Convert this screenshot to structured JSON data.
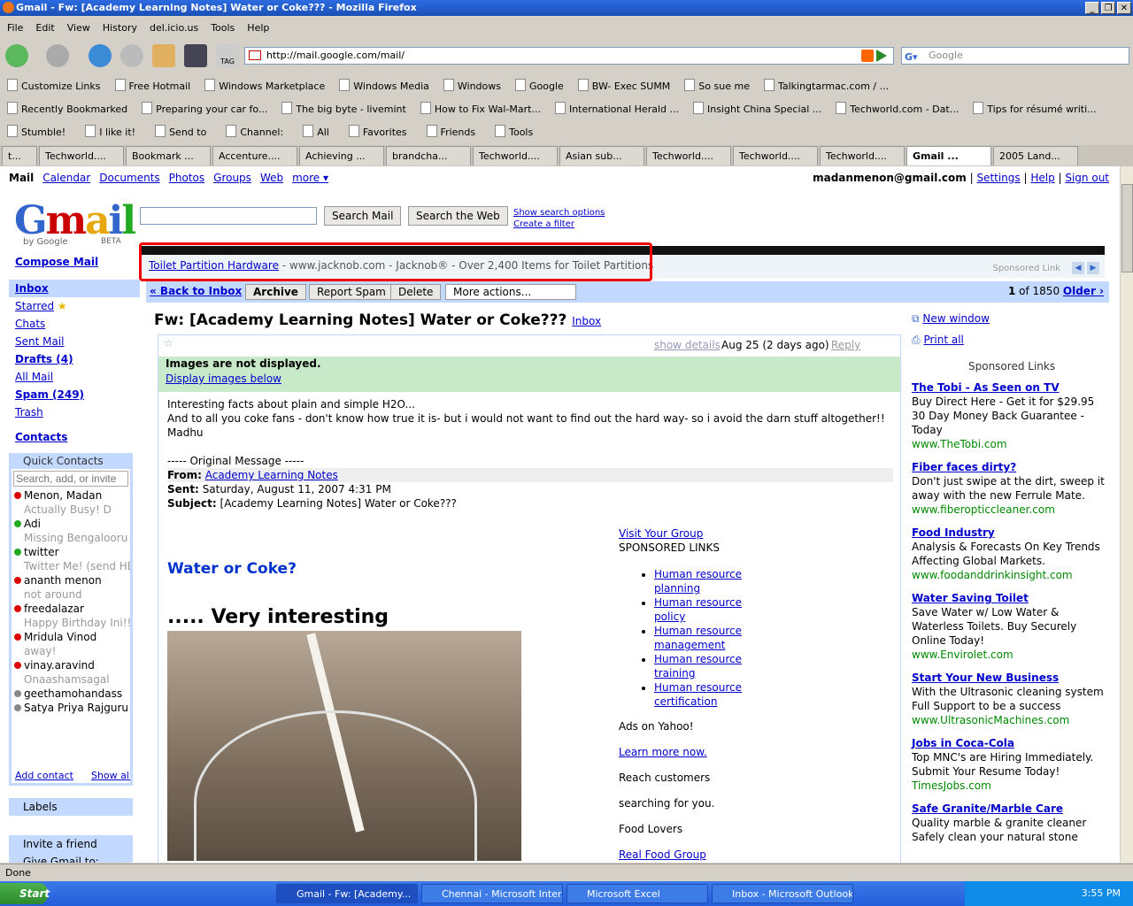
{
  "window": {
    "title": "Gmail - Fw: [Academy Learning Notes] Water or Coke??? - Mozilla Firefox"
  },
  "menu": [
    "File",
    "Edit",
    "View",
    "History",
    "del.icio.us",
    "Tools",
    "Help"
  ],
  "url": "http://mail.google.com/mail/",
  "search_placeholder": "Google",
  "bookmarks1": [
    "Customize Links",
    "Free Hotmail",
    "Windows Marketplace",
    "Windows Media",
    "Windows",
    "Google",
    "BW- Exec SUMM",
    "So sue me",
    "Talkingtarmac.com / ..."
  ],
  "bookmarks2": [
    "Recently Bookmarked",
    "Preparing your car fo...",
    "The big byte - livemint",
    "How to Fix Wal-Mart...",
    "International Herald ...",
    "Insight China Special ...",
    "Techworld.com - Dat...",
    "Tips for résumé writi..."
  ],
  "stumble": [
    "Stumble!",
    "I like it!",
    "Send to",
    "Channel:",
    "All",
    "Favorites",
    "Friends",
    "Tools"
  ],
  "tabs": [
    "t...",
    "Techworld....",
    "Bookmark ...",
    "Accenture....",
    "Achieving ...",
    "brandcha...",
    "Techworld....",
    "Asian sub...",
    "Techworld....",
    "Techworld....",
    "Techworld....",
    "Gmail ...",
    "2005 Land..."
  ],
  "gmail": {
    "top_links": [
      "Mail",
      "Calendar",
      "Documents",
      "Photos",
      "Groups",
      "Web",
      "more ▾"
    ],
    "user": "madanmenon@gmail.com",
    "settings": "Settings",
    "help": "Help",
    "signout": "Sign out",
    "search_mail": "Search Mail",
    "search_web": "Search the Web",
    "show_opts": "Show search options",
    "create_filter": "Create a filter",
    "logo": "Gmail",
    "logo_sub": "by Google",
    "logo_beta": "BETA",
    "ad_link": "Toilet Partition Hardware",
    "ad_rest": " - www.jacknob.com - Jacknob® - Over 2,400 Items for Toilet Partitions",
    "ad_sponsor": "Sponsored Link",
    "compose": "Compose Mail",
    "nav": [
      "Inbox",
      "Starred",
      "Chats",
      "Sent Mail",
      "Drafts (4)",
      "All Mail",
      "Spam (249)",
      "Trash"
    ],
    "contacts": "Contacts",
    "qc_title": "Quick Contacts",
    "qc_placeholder": "Search, add, or invite",
    "qc_list": [
      {
        "n": "Menon, Madan",
        "s": "Actually Busy! D",
        "c": "#d00"
      },
      {
        "n": "Adi",
        "s": "Missing Bengalooru",
        "c": "#2a2"
      },
      {
        "n": "twitter",
        "s": "Twitter Me! (send HE",
        "c": "#2a2"
      },
      {
        "n": "ananth menon",
        "s": "not around",
        "c": "#d00"
      },
      {
        "n": "freedalazar",
        "s": "Happy Birthday Ini!!",
        "c": "#d00"
      },
      {
        "n": "Mridula Vinod",
        "s": "away!",
        "c": "#d00"
      },
      {
        "n": "vinay.aravind",
        "s": "Onaashamsagal",
        "c": "#d00"
      },
      {
        "n": "geethamohandass",
        "s": "",
        "c": "#888"
      },
      {
        "n": "Satya Priya Rajguru",
        "s": "",
        "c": "#888"
      }
    ],
    "add_contact": "Add contact",
    "show_all": "Show all",
    "labels": "Labels",
    "invite": "Invite a friend",
    "invite_sub": "Give Gmail to:",
    "back": "« Back to Inbox",
    "archive": "Archive",
    "report": "Report Spam",
    "delete": "Delete",
    "more_actions": "More actions...",
    "count": "1",
    "of": "of 1850",
    "older": "Older ›",
    "subject": "Fw: [Academy Learning Notes] Water or Coke???",
    "inbox_label": "Inbox",
    "show_details": "show details",
    "date": "Aug 25 (2 days ago)",
    "reply": "Reply",
    "img_warn": "Images are not displayed.",
    "display_images": "Display images below",
    "body": [
      "Interesting facts about plain and simple H2O...",
      "And to all you coke fans - don't know how true it is- but i would not want to find out the hard way- so i avoid the darn stuff altogether!!",
      "Madhu"
    ],
    "orig": "----- Original Message -----",
    "from_l": "From:",
    "from": "Academy Learning Notes",
    "sent_l": "Sent:",
    "sent": "Saturday, August 11, 2007 4:31 PM",
    "subj_l": "Subject:",
    "subj": "[Academy Learning Notes] Water or Coke???",
    "h1": "Water or Coke?",
    "h2": "..... Very interesting",
    "visit": "Visit Your Group",
    "sponsored_links": "SPONSORED LINKS",
    "hr_links": [
      "Human resource planning",
      "Human resource policy",
      "Human resource management",
      "Human resource training",
      "Human resource certification"
    ],
    "yahoo": "Ads on Yahoo!",
    "learn": "Learn more now.",
    "reach": "Reach customers",
    "searching": "searching for you.",
    "food": "Food Lovers",
    "real_food": "Real Food Group",
    "new_window": "New window",
    "print_all": "Print all",
    "side_sponsored": "Sponsored Links",
    "ads": [
      {
        "t": "The Tobi - As Seen on TV",
        "d": "Buy Direct Here - Get it for $29.95 30 Day Money Back Guarantee - Today",
        "u": "www.TheTobi.com"
      },
      {
        "t": "Fiber faces dirty?",
        "d": "Don't just swipe at the dirt, sweep it away with the new Ferrule Mate.",
        "u": "www.fiberopticcleaner.com"
      },
      {
        "t": "Food Industry",
        "d": "Analysis & Forecasts On Key Trends Affecting Global Markets.",
        "u": "www.foodanddrinkinsight.com"
      },
      {
        "t": "Water Saving Toilet",
        "d": "Save Water w/ Low Water & Waterless Toilets. Buy Securely Online Today!",
        "u": "www.Envirolet.com"
      },
      {
        "t": "Start Your New Business",
        "d": "With the Ultrasonic cleaning system Full Support to be a success",
        "u": "www.UltrasonicMachines.com"
      },
      {
        "t": "Jobs in Coca-Cola",
        "d": "Top MNC's are Hiring Immediately. Submit Your Resume Today!",
        "u": "TimesJobs.com"
      },
      {
        "t": "Safe Granite/Marble Care",
        "d": "Quality marble & granite cleaner Safely clean your natural stone",
        "u": ""
      }
    ]
  },
  "status": "Done",
  "taskbar": {
    "start": "Start",
    "items": [
      "Gmail - Fw: [Academy...",
      "Chennai - Microsoft Inter...",
      "Microsoft Excel",
      "Inbox - Microsoft Outlook"
    ],
    "time": "3:55 PM"
  }
}
